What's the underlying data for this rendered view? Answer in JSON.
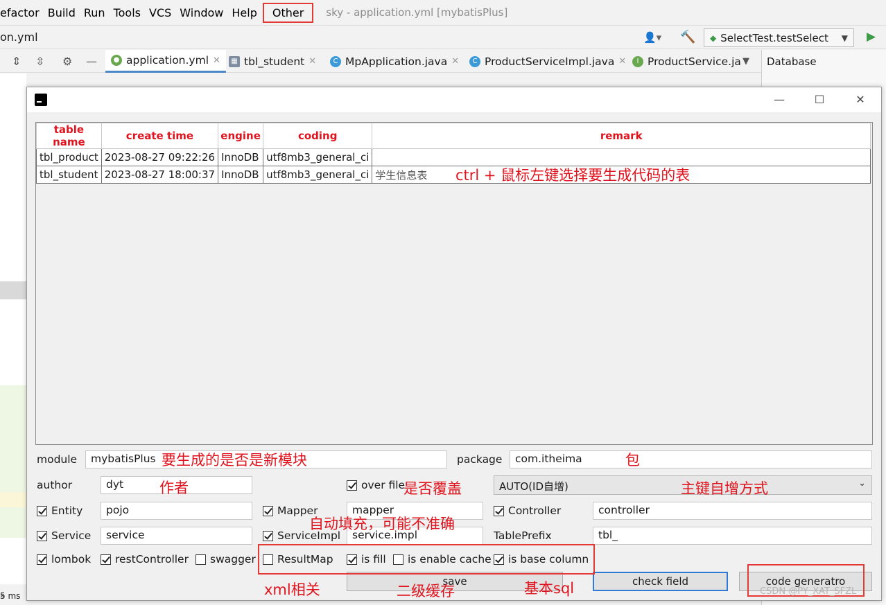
{
  "menu": {
    "items": [
      "efactor",
      "Build",
      "Run",
      "Tools",
      "VCS",
      "Window",
      "Help"
    ],
    "other": "Other",
    "window_title": "sky - application.yml [mybatisPlus]"
  },
  "toolbar": {
    "breadcrumb": "on.yml",
    "run_config": "SelectTest.testSelect"
  },
  "tabs": [
    {
      "label": "application.yml",
      "icon": "yaml-icon"
    },
    {
      "label": "tbl_student",
      "icon": "table-icon"
    },
    {
      "label": "MpApplication.java",
      "icon": "class-icon"
    },
    {
      "label": "ProductServiceImpl.java",
      "icon": "class-icon"
    },
    {
      "label": "ProductService.ja",
      "icon": "interface-icon"
    }
  ],
  "database_panel": {
    "title": "Database"
  },
  "status": {
    "timing": "5 ms",
    "collapse": "»"
  },
  "dialog": {
    "columns": [
      "table name",
      "create time",
      "engine",
      "coding",
      "remark"
    ],
    "rows": [
      [
        "tbl_product",
        "2023-08-27 09:22:26",
        "InnoDB",
        "utf8mb3_general_ci",
        ""
      ],
      [
        "tbl_student",
        "2023-08-27 18:00:37",
        "InnoDB",
        "utf8mb3_general_ci",
        "学生信息表"
      ]
    ],
    "module_label": "module",
    "module_value": "mybatisPlus",
    "package_label": "package",
    "package_value": "com.itheima",
    "author_label": "author",
    "author_value": "dyt",
    "over_file_label": "over file",
    "id_strategy": "AUTO(ID自增)",
    "entity_label": "Entity",
    "entity_value": "pojo",
    "mapper_label": "Mapper",
    "mapper_value": "mapper",
    "controller_label": "Controller",
    "controller_value": "controller",
    "service_label": "Service",
    "service_value": "service",
    "serviceimpl_label": "ServiceImpl",
    "serviceimpl_value": "service.impl",
    "tableprefix_label": "TablePrefix",
    "tableprefix_value": "tbl_",
    "opt_lombok": "lombok",
    "opt_restcontroller": "restController",
    "opt_swagger": "swagger",
    "opt_resultmap": "ResultMap",
    "opt_isfill": "is fill",
    "opt_cache": "is enable cache",
    "opt_basecolumn": "is base column",
    "btn_save": "save",
    "btn_check": "check field",
    "btn_generate": "code generatro"
  },
  "annotations": {
    "select_tables": "ctrl + 鼠标左键选择要生成代码的表",
    "new_module": "要生成的是否是新模块",
    "package": "包",
    "author": "作者",
    "overwrite": "是否覆盖",
    "pk_strategy": "主键自增方式",
    "auto_fill": "自动填充，可能不准确",
    "xml": "xml相关",
    "cache": "二级缓存",
    "base_sql": "基本sql"
  },
  "watermark": "CSDN @PY_XAT_SFZL"
}
